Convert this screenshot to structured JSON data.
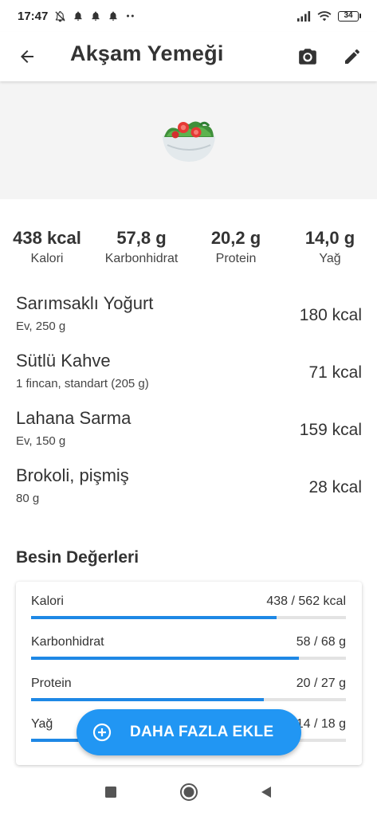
{
  "status_bar": {
    "time": "17:47",
    "battery": "34",
    "icons": [
      "mute-notifications-icon",
      "bell-icon",
      "bell-icon",
      "bell-icon",
      "more-dots-icon",
      "signal-icon",
      "wifi-icon",
      "battery-icon"
    ]
  },
  "app_bar": {
    "title": "Akşam Yemeği",
    "back_icon": "arrow-left-icon",
    "camera_icon": "camera-icon",
    "edit_icon": "pencil-icon"
  },
  "hero": {
    "icon": "salad-bowl-icon"
  },
  "summary": [
    {
      "value": "438 kcal",
      "label": "Kalori"
    },
    {
      "value": "57,8 g",
      "label": "Karbonhidrat"
    },
    {
      "value": "20,2 g",
      "label": "Protein"
    },
    {
      "value": "14,0 g",
      "label": "Yağ"
    }
  ],
  "foods": [
    {
      "name": "Sarımsaklı Yoğurt",
      "portion": "Ev, 250 g",
      "kcal": "180 kcal"
    },
    {
      "name": "Sütlü Kahve",
      "portion": "1 fincan, standart (205 g)",
      "kcal": "71 kcal"
    },
    {
      "name": "Lahana Sarma",
      "portion": "Ev, 150 g",
      "kcal": "159 kcal"
    },
    {
      "name": "Brokoli, pişmiş",
      "portion": "80 g",
      "kcal": "28 kcal"
    }
  ],
  "nutrition": {
    "title": "Besin Değerleri",
    "rows": [
      {
        "label": "Kalori",
        "value": "438 / 562 kcal",
        "progress": 0.78
      },
      {
        "label": "Karbonhidrat",
        "value": "58 / 68 g",
        "progress": 0.85
      },
      {
        "label": "Protein",
        "value": "20 / 27 g",
        "progress": 0.74
      },
      {
        "label": "Yağ",
        "value": "14 / 18 g",
        "progress": 0.78
      }
    ]
  },
  "fab": {
    "label": "DAHA FAZLA EKLE",
    "icon": "plus-circle-icon"
  },
  "nav": {
    "icons": [
      "recents-square-icon",
      "home-circle-icon",
      "back-triangle-icon"
    ]
  },
  "colors": {
    "accent": "#2196f3",
    "progress": "#1e88e5",
    "hero_bg": "#f4f4f4"
  }
}
